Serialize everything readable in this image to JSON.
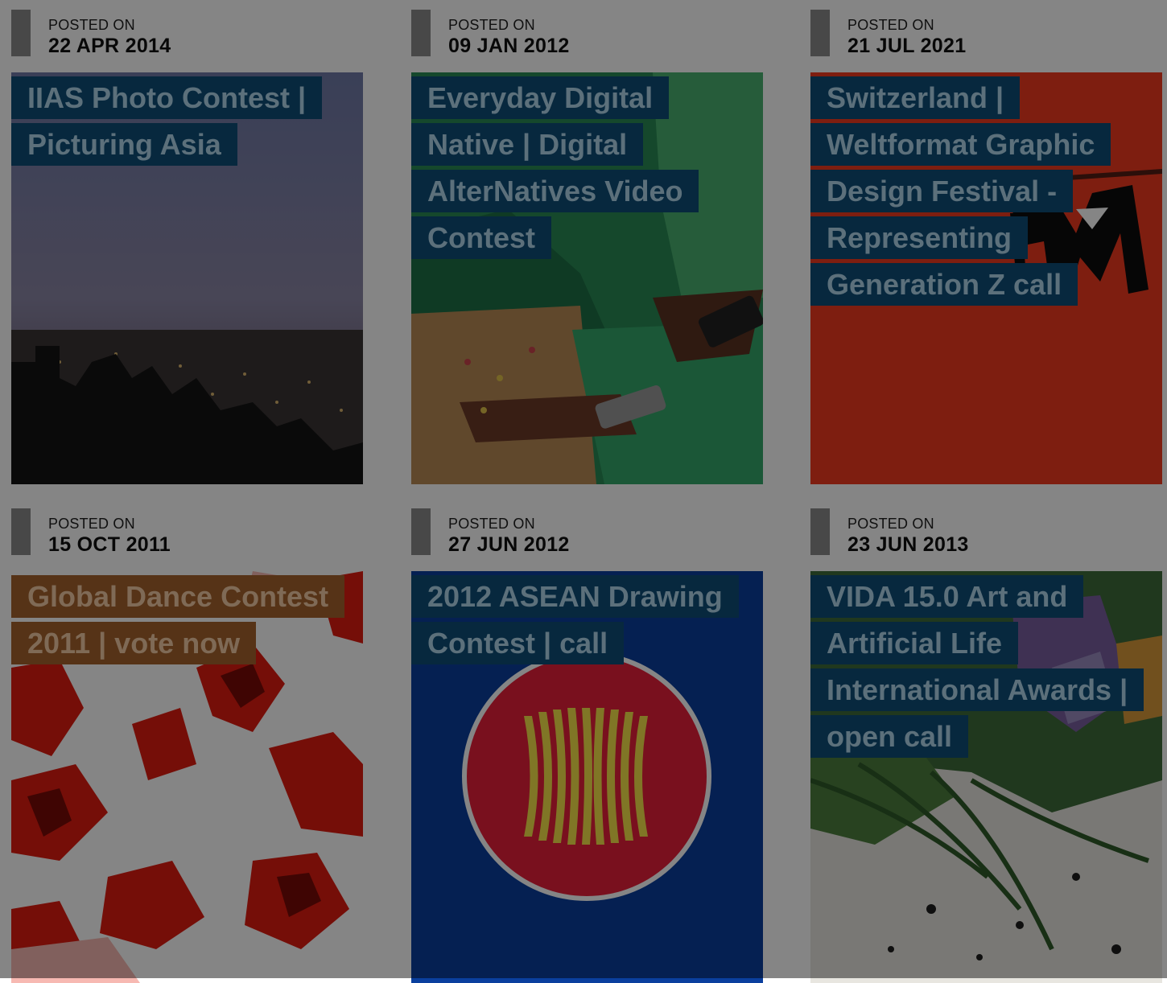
{
  "posts": [
    {
      "posted_label": "POSTED ON",
      "date": "22 APR 2014",
      "title": "IIAS Photo Contest | Picturing Asia",
      "image": "city-night-skyline"
    },
    {
      "posted_label": "POSTED ON",
      "date": "09 JAN 2012",
      "title": "Everyday Digital Native | Digital AlterNatives Video Contest",
      "image": "women-with-mobile-phones"
    },
    {
      "posted_label": "POSTED ON",
      "date": "21 JUL 2021",
      "title": "Switzerland | Weltformat Graphic Design Festival - Representing Generation Z call",
      "image": "red-poster-graphic"
    },
    {
      "posted_label": "POSTED ON",
      "date": "15 OCT 2011",
      "title": "Global Dance Contest 2011 | vote now",
      "image": "red-dancers-graphic"
    },
    {
      "posted_label": "POSTED ON",
      "date": "27 JUN 2012",
      "title": "2012 ASEAN Drawing Contest | call",
      "image": "asean-emblem"
    },
    {
      "posted_label": "POSTED ON",
      "date": "23 JUN 2013",
      "title": "VIDA 15.0 Art and Artificial Life International Awards | open call",
      "image": "green-organic-artwork"
    }
  ]
}
